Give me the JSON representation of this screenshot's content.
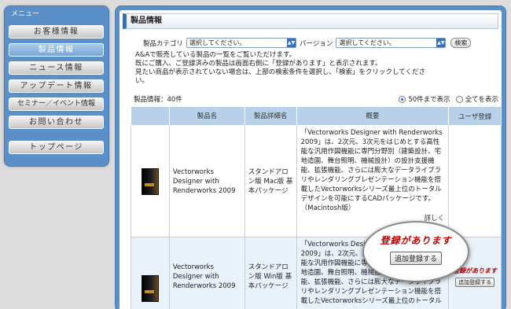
{
  "sidebar": {
    "heading": "メニュー",
    "items": [
      {
        "label": "お客様情報"
      },
      {
        "label": "製品情報"
      },
      {
        "label": "ニュース情報"
      },
      {
        "label": "アップデート情報"
      },
      {
        "label": "セミナー／イベント情報"
      },
      {
        "label": "お問い合わせ"
      }
    ],
    "top_page": "トップページ"
  },
  "main": {
    "title": "製品情報",
    "search": {
      "category_label": "製品カテゴリ",
      "category_value": "選択してください。",
      "version_label": "バージョン",
      "version_value": "選択してください。",
      "button": "検索"
    },
    "description": [
      "A&Aで販売している製品の一覧をご覧いただけます。",
      "既にご購入、ご登録済みの製品は画面右側に「登録があります」と表示されます。",
      "見たい商品が表示されていない場合は、上部の検索条件を選択し、「検索」をクリックしてくださ",
      "い。"
    ],
    "count_label": "製品情報：40件",
    "display_options": [
      "50件まで表示",
      "全てを表示"
    ],
    "table": {
      "headers": [
        "",
        "製品名",
        "製品詳細名",
        "概要",
        "ユーザ登録"
      ],
      "rows": [
        {
          "name": "Vectorworks Designer with Renderworks 2009",
          "detail": "スタンドアロン版 Mac版 基本パッケージ",
          "summary": "「Vectorworks Designer with Renderworks 2009」は、2次元、3次元をはじめとする高性能な汎用作図機能に専門分野別（建築設計、宅地造園、舞台照明、機械設計）の設計支援機能、拡張機能、さらには膨大なデータライブラリやレンダリングプレゼンテーション機能を搭載したVectorworksシリーズ最上位のトータルデザインを可能にするCADパッケージです。（Macintosh版）",
          "more": "詳しく",
          "registered": "",
          "add_button": ""
        },
        {
          "name": "Vectorworks Designer with Renderworks 2009",
          "detail": "スタンドアロン版 Win版 基本パッケージ",
          "summary": "「Vectorworks Designer with Renderworks 2009」は、2次元、3次元をはじめとする高性能な汎用作図機能に専門分野別（建築設計、宅地造園、舞台照明、機械設計）の設計支援機能、拡張機能、さらには膨大なデータライブラリやレンダリングプレゼンテーション機能を搭載したVectorworksシリーズ最上位のトータル",
          "more": "",
          "registered": "登録があります",
          "add_button": "追加登録する"
        }
      ]
    },
    "callout": {
      "text": "登録があります",
      "button": "追加登録する"
    }
  },
  "colors": {
    "frame_blue": "#5b8fc7",
    "header_blue": "#b8d1e8",
    "registered_red": "#c00000"
  }
}
